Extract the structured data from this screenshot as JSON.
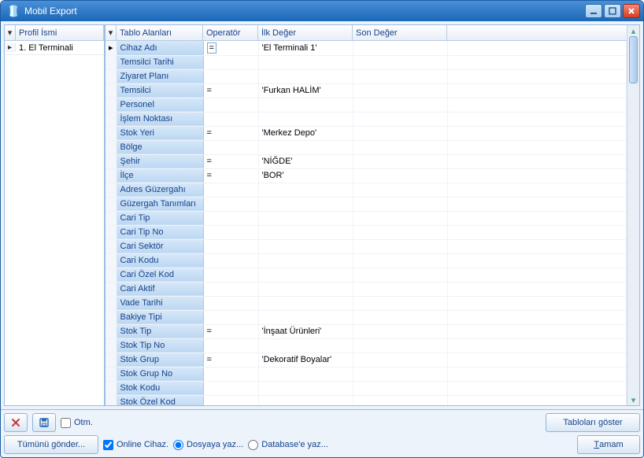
{
  "window": {
    "title": "Mobil Export"
  },
  "left": {
    "header": "Profil İsmi",
    "row_label": "1. El Terminali"
  },
  "grid": {
    "columns": {
      "field": "Tablo Alanları",
      "op": "Operatör",
      "first": "İlk Değer",
      "last": "Son Değer"
    },
    "rows": [
      {
        "field": "Cihaz Adı",
        "op": "=",
        "first": "'El Terminali 1'",
        "last": "",
        "current": true
      },
      {
        "field": "Temsilci Tarihi",
        "op": "",
        "first": "",
        "last": ""
      },
      {
        "field": "Ziyaret Planı",
        "op": "",
        "first": "",
        "last": ""
      },
      {
        "field": "Temsilci",
        "op": "=",
        "first": "'Furkan HALİM'",
        "last": ""
      },
      {
        "field": "Personel",
        "op": "",
        "first": "",
        "last": ""
      },
      {
        "field": "İşlem Noktası",
        "op": "",
        "first": "",
        "last": ""
      },
      {
        "field": "Stok Yeri",
        "op": "=",
        "first": "'Merkez Depo'",
        "last": ""
      },
      {
        "field": "Bölge",
        "op": "",
        "first": "",
        "last": ""
      },
      {
        "field": "Şehir",
        "op": "=",
        "first": "'NİĞDE'",
        "last": ""
      },
      {
        "field": "İlçe",
        "op": "=",
        "first": "'BOR'",
        "last": ""
      },
      {
        "field": "Adres Güzergahı",
        "op": "",
        "first": "",
        "last": ""
      },
      {
        "field": "Güzergah Tanımları",
        "op": "",
        "first": "",
        "last": ""
      },
      {
        "field": "Cari Tip",
        "op": "",
        "first": "",
        "last": ""
      },
      {
        "field": "Cari Tip No",
        "op": "",
        "first": "",
        "last": ""
      },
      {
        "field": "Cari Sektör",
        "op": "",
        "first": "",
        "last": ""
      },
      {
        "field": "Cari Kodu",
        "op": "",
        "first": "",
        "last": ""
      },
      {
        "field": "Cari Özel Kod",
        "op": "",
        "first": "",
        "last": ""
      },
      {
        "field": "Cari Aktif",
        "op": "",
        "first": "",
        "last": ""
      },
      {
        "field": "Vade Tarihi",
        "op": "",
        "first": "",
        "last": ""
      },
      {
        "field": "Bakiye Tipi",
        "op": "",
        "first": "",
        "last": ""
      },
      {
        "field": "Stok Tip",
        "op": "=",
        "first": "'İnşaat Ürünleri'",
        "last": ""
      },
      {
        "field": "Stok Tip No",
        "op": "",
        "first": "",
        "last": ""
      },
      {
        "field": "Stok Grup",
        "op": "=",
        "first": "'Dekoratif Boyalar'",
        "last": ""
      },
      {
        "field": "Stok Grup No",
        "op": "",
        "first": "",
        "last": ""
      },
      {
        "field": "Stok Kodu",
        "op": "",
        "first": "",
        "last": ""
      },
      {
        "field": "Stok Özel Kod",
        "op": "",
        "first": "",
        "last": ""
      }
    ]
  },
  "footer": {
    "otm_label": "Otm.",
    "otm_checked": false,
    "show_tables": "Tabloları göster",
    "send_all": "Tümünü gönder...",
    "online_device_label": "Online Cihaz.",
    "online_device_checked": true,
    "write_file": "Dosyaya yaz...",
    "write_db": "Database'e yaz...",
    "write_selected": "file",
    "ok": "Tamam"
  }
}
